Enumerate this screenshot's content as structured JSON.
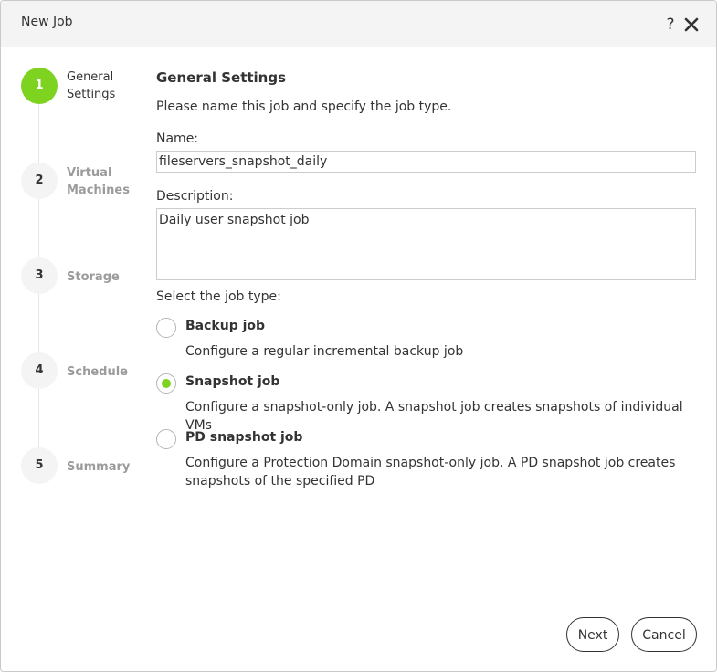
{
  "dialog": {
    "title": "New Job",
    "help_icon": "question-mark-icon",
    "close_icon": "close-x-icon"
  },
  "steps": [
    {
      "number": "1",
      "label_line1": "General",
      "label_line2": "Settings",
      "active": true
    },
    {
      "number": "2",
      "label_line1": "Virtual",
      "label_line2": "Machines",
      "active": false
    },
    {
      "number": "3",
      "label_line1": "Storage",
      "label_line2": "",
      "active": false
    },
    {
      "number": "4",
      "label_line1": "Schedule",
      "label_line2": "",
      "active": false
    },
    {
      "number": "5",
      "label_line1": "Summary",
      "label_line2": "",
      "active": false
    }
  ],
  "form": {
    "section_title": "General Settings",
    "intro": "Please name this job and specify the job type.",
    "name_label": "Name:",
    "name_value": "fileservers_snapshot_daily",
    "description_label": "Description:",
    "description_value": "Daily user snapshot job",
    "job_type_label": "Select the job type:",
    "job_types": [
      {
        "title": "Backup job",
        "description": "Configure a regular incremental backup job",
        "selected": false
      },
      {
        "title": "Snapshot job",
        "description": "Configure a snapshot-only job. A snapshot job creates snapshots of individual VMs",
        "selected": true
      },
      {
        "title": "PD snapshot job",
        "description": "Configure a Protection Domain snapshot-only job. A PD snapshot job creates snapshots of the specified PD",
        "selected": false
      }
    ]
  },
  "footer": {
    "next_label": "Next",
    "cancel_label": "Cancel"
  },
  "colors": {
    "accent": "#7ed321",
    "titlebar_bg": "#f4f4f4",
    "inactive_text": "#9b9b9b"
  }
}
